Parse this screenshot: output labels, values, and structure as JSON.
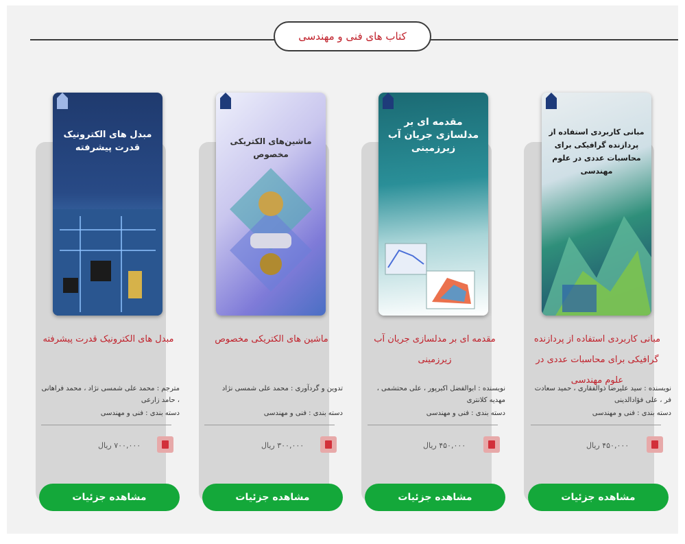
{
  "section": {
    "title": "کتاب های فنی و مهندسی"
  },
  "books": [
    {
      "cover_text": "مبانی کاربردی استفاده از پردازنده گرافیکی برای محاسبات عددی در علوم مهندسی",
      "title": "مبانی کاربردی استفاده از پردازنده گرافیکی برای محاسبات عددی در علوم مهندسی",
      "authors": "نویسنده : سید علیرضا ذوالفقاری ، حمید سعادت فر ، علی فؤادالدینی",
      "category": "دسته بندی : فنی و مهندسی",
      "price": "۴۵۰,۰۰۰ ریال",
      "button": "مشاهده جزئیات"
    },
    {
      "cover_text": "مقدمه ای بر مدلسازی جریان آب زیرزمینی",
      "title": "مقدمه ای بر مدلسازی جریان آب زیرزمینی",
      "authors": "نویسنده : ابوالفضل اکبرپور ، علی محتشمی ، مهدیه کلانتری",
      "category": "دسته بندی : فنی و مهندسی",
      "price": "۴۵۰,۰۰۰ ریال",
      "button": "مشاهده جزئیات"
    },
    {
      "cover_text": "ماشین‌های الکتریکی مخصوص",
      "title": "ماشین های الکتریکی مخصوص",
      "authors": "تدوین و گردآوری : محمد علی شمسی نژاد",
      "category": "دسته بندی : فنی و مهندسی",
      "price": "۳۰۰,۰۰۰ ریال",
      "button": "مشاهده جزئیات"
    },
    {
      "cover_text": "مبدل های الکترونیک قدرت پیشرفته",
      "title": "مبدل های الکترونیک قدرت پیشرفته",
      "authors": "مترجم : محمد علی شمسی نژاد ، محمد فراهانی ، حامد زارعی",
      "category": "دسته بندی : فنی و مهندسی",
      "price": "۷۰۰,۰۰۰ ریال",
      "button": "مشاهده جزئیات"
    }
  ],
  "colors": {
    "accent": "#c0202a",
    "button": "#14a83a",
    "card": "#d6d6d6"
  },
  "icons": {
    "cart": "cart-icon",
    "emblem": "university-emblem-icon"
  }
}
